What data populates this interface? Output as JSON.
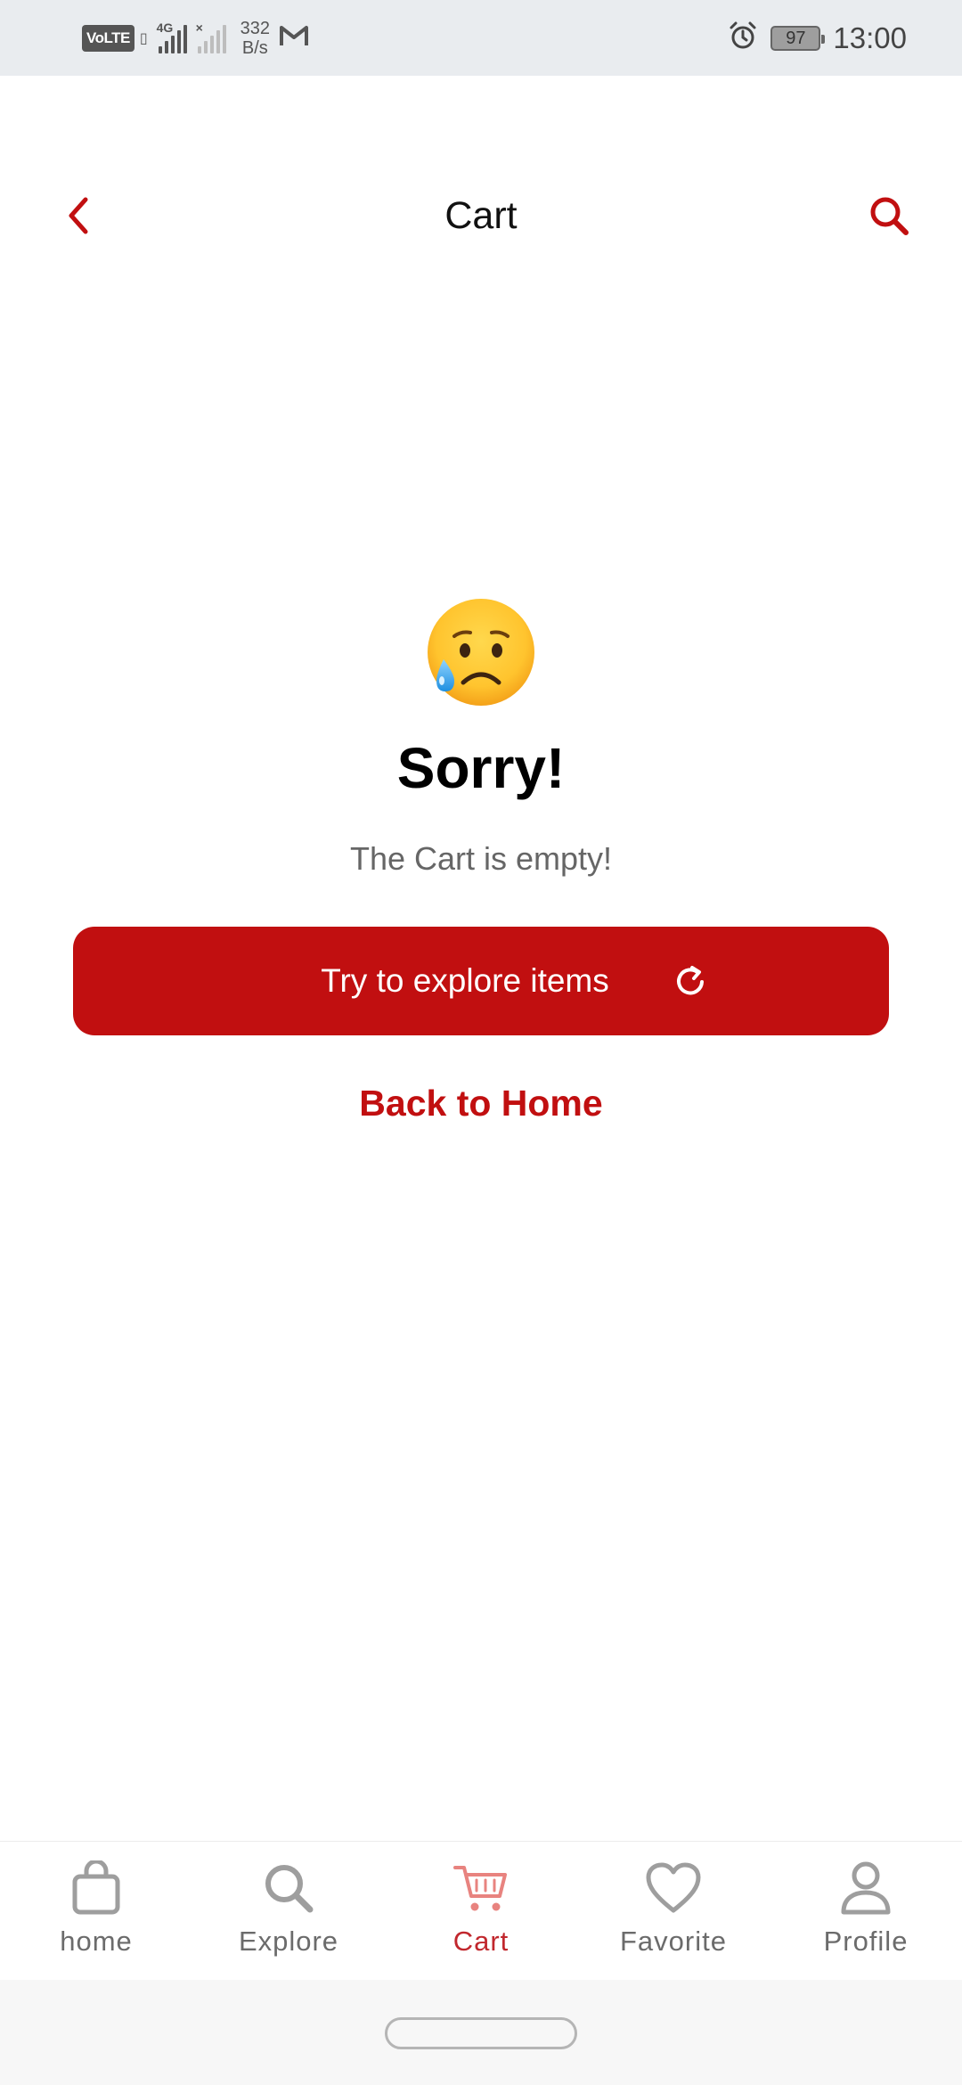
{
  "status_bar": {
    "volte": "VoLTE",
    "network_type": "4G",
    "speed_value": "332",
    "speed_unit": "B/s",
    "battery": "97",
    "time": "13:00"
  },
  "header": {
    "title": "Cart",
    "back_icon": "chevron-left-icon",
    "search_icon": "search-icon"
  },
  "empty_state": {
    "emoji": "sad-tear-emoji",
    "heading": "Sorry!",
    "message": "The Cart is empty!",
    "explore_button": "Try to explore items",
    "explore_icon": "refresh-icon",
    "home_link": "Back to Home"
  },
  "bottom_nav": {
    "items": [
      {
        "label": "home",
        "icon": "shopping-bag-icon",
        "active": false
      },
      {
        "label": "Explore",
        "icon": "search-icon",
        "active": false
      },
      {
        "label": "Cart",
        "icon": "cart-icon",
        "active": true
      },
      {
        "label": "Favorite",
        "icon": "heart-icon",
        "active": false
      },
      {
        "label": "Profile",
        "icon": "user-icon",
        "active": false
      }
    ]
  },
  "colors": {
    "accent": "#c10f10",
    "active_nav": "#c1272d",
    "inactive_nav": "#9e9e9e",
    "status_bar_bg": "#e9ecef"
  }
}
